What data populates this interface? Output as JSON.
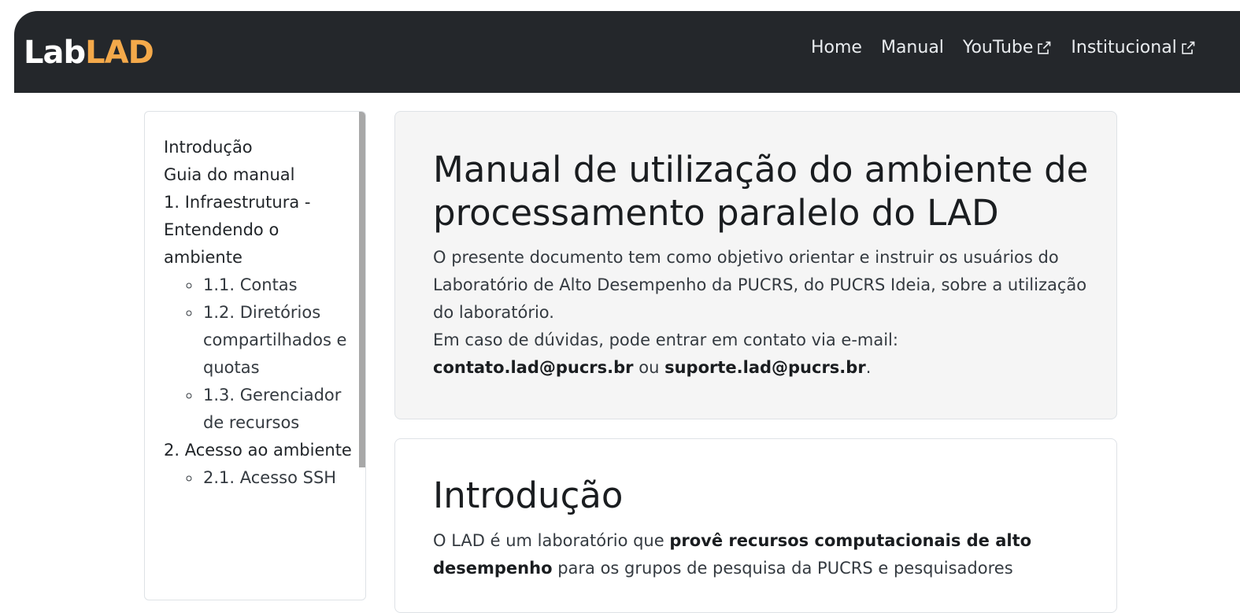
{
  "header": {
    "brand_part1": "Lab",
    "brand_part2": "LAD",
    "nav": [
      {
        "label": "Home"
      },
      {
        "label": "Manual"
      },
      {
        "label": "YouTube",
        "icon": "external-link-icon"
      },
      {
        "label": "Institucional",
        "icon": "external-link-icon"
      }
    ]
  },
  "sidebar": {
    "items": [
      {
        "label": "Introdução"
      },
      {
        "label": "Guia do manual"
      },
      {
        "label": "1. Infraestrutura - Entendendo o ambiente",
        "subitems": [
          "1.1. Contas",
          "1.2. Diretórios compartilhados e quotas",
          "1.3. Gerenciador de recursos"
        ]
      },
      {
        "label": "2. Acesso ao ambiente",
        "subitems": [
          "2.1. Acesso SSH"
        ]
      }
    ]
  },
  "hero": {
    "title": "Manual de utilização do ambiente de processamento paralelo do LAD",
    "text1": "O presente documento tem como objetivo orientar e instruir os usuários do Laboratório de Alto Desempenho da PUCRS, do PUCRS Ideia, sobre a utilização do laboratório.",
    "text2": "Em caso de dúvidas, pode entrar em contato via e-mail:",
    "email1": "contato.lad@pucrs.br",
    "or": "ou",
    "email2": "suporte.lad@pucrs.br",
    "period": "."
  },
  "intro": {
    "title": "Introdução",
    "text_a": "O LAD é um laboratório que",
    "text_bold": "provê recursos computacionais de alto desempenho",
    "text_b": "para os grupos de pesquisa da PUCRS e pesquisadores"
  },
  "colors": {
    "navbar": "#24272b",
    "brand_accent": "#f4a94a",
    "card_bg": "#f5f5f5"
  }
}
